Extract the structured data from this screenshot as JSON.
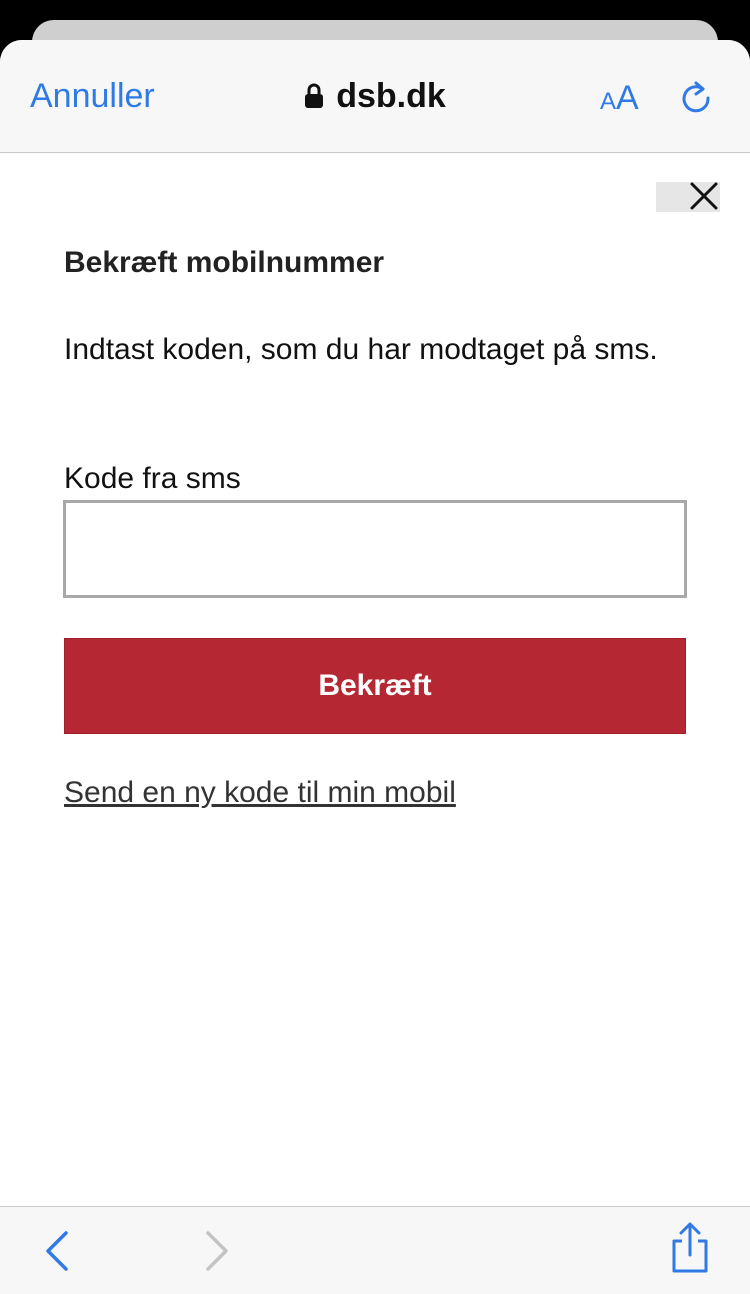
{
  "browser": {
    "cancel_label": "Annuller",
    "domain": "dsb.dk",
    "text_size_small": "A",
    "text_size_big": "A"
  },
  "dialog": {
    "title": "Bekræft mobilnummer",
    "instruction": "Indtast koden, som du har modtaget på sms.",
    "code_label": "Kode fra sms",
    "code_value": "",
    "confirm_label": "Bekræft",
    "resend_link": "Send en ny kode til min mobil"
  },
  "icons": {
    "lock": "lock-icon",
    "reload": "reload-icon",
    "close": "close-icon",
    "back": "chevron-left-icon",
    "forward": "chevron-right-icon",
    "share": "share-icon"
  },
  "colors": {
    "accent": "#2f7ae5",
    "brand_red": "#b52733",
    "disabled": "#c4c4c4"
  }
}
